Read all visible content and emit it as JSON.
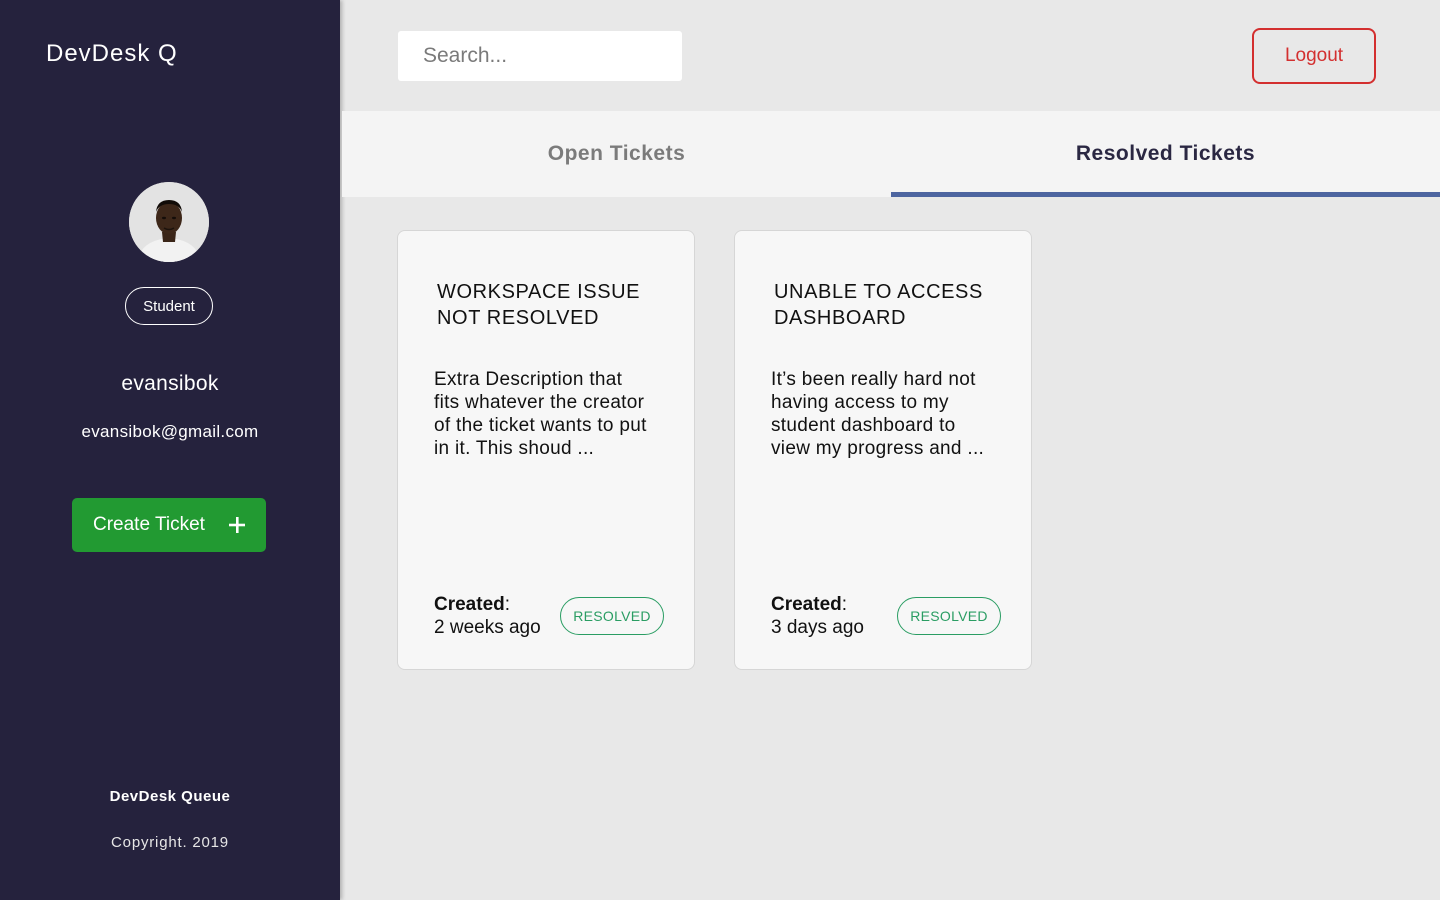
{
  "sidebar": {
    "brand": "DevDesk Q",
    "role": "Student",
    "username": "evansibok",
    "email": "evansibok@gmail.com",
    "create_button_label": "Create Ticket",
    "create_button_icon": "plus-icon",
    "footer_title": "DevDesk Queue",
    "footer_copyright": "Copyright. 2019"
  },
  "topbar": {
    "search_placeholder": "Search...",
    "search_value": "",
    "logout_label": "Logout"
  },
  "tabs": [
    {
      "label": "Open Tickets",
      "active": false
    },
    {
      "label": "Resolved Tickets",
      "active": true
    }
  ],
  "tickets": [
    {
      "title": "WORKSPACE ISSUE NOT RESOLVED",
      "description": "Extra Description that fits whatever the creator of the ticket wants to put in it. This shoud ...",
      "created_label": "Created",
      "created_value": "2 weeks ago",
      "status": "RESOLVED"
    },
    {
      "title": "UNABLE TO ACCESS DASHBOARD",
      "description": "It’s been really hard not having access to my student dashboard to view my progress and ...",
      "created_label": "Created",
      "created_value": "3 days ago",
      "status": "RESOLVED"
    }
  ],
  "colors": {
    "sidebar_bg": "#25223d",
    "create_button": "#229a32",
    "logout": "#d32f2f",
    "active_tab_indicator": "#4d65a0",
    "resolved_badge": "#2a9d63",
    "page_bg": "#e8e8e8"
  }
}
